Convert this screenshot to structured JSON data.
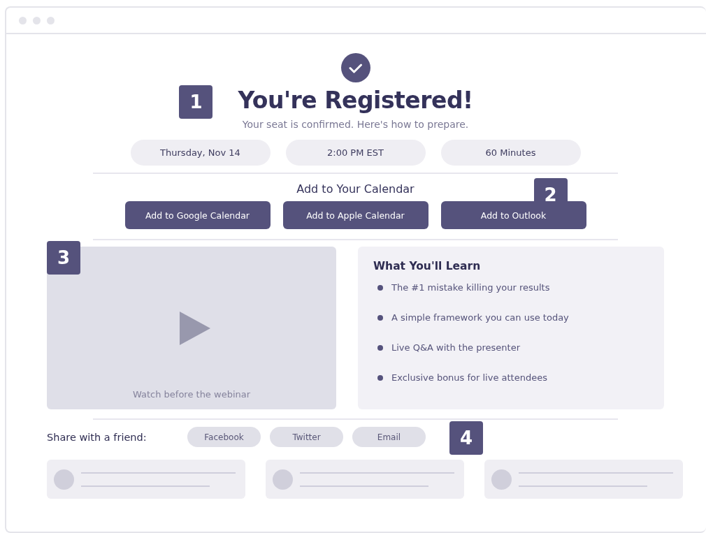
{
  "title": "You're Registered!",
  "subtitle": "Your seat is confirmed. Here's how to prepare.",
  "details": [
    "Thursday, Nov 14",
    "2:00 PM EST",
    "60 Minutes"
  ],
  "calendar": {
    "heading": "Add to Your Calendar",
    "buttons": [
      "Add to Google Calendar",
      "Add to Apple Calendar",
      "Add to Outlook"
    ]
  },
  "video": {
    "caption": "Watch before the webinar"
  },
  "learn": {
    "heading": "What You'll Learn",
    "items": [
      "The #1 mistake killing your results",
      "A simple framework you can use today",
      "Live Q&A with the presenter",
      "Exclusive bonus for live attendees"
    ]
  },
  "share": {
    "label": "Share with a friend:",
    "buttons": [
      "Facebook",
      "Twitter",
      "Email"
    ]
  },
  "markers": [
    "1",
    "2",
    "3",
    "4"
  ]
}
